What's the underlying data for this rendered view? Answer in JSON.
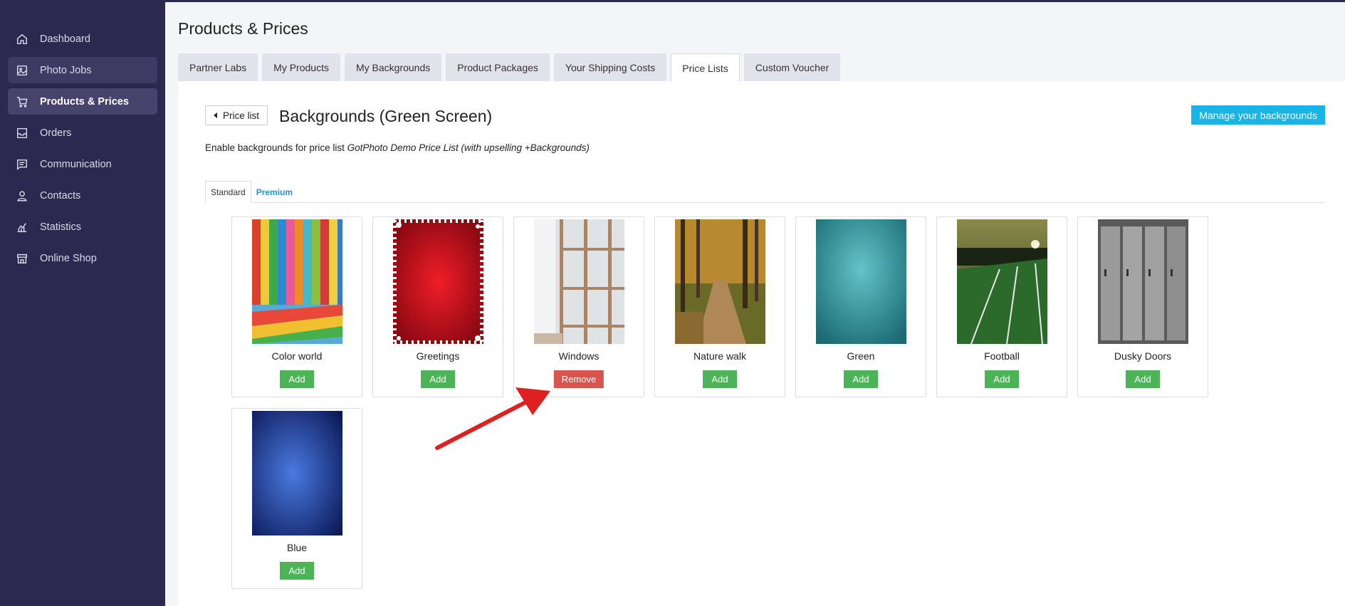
{
  "sidebar": {
    "items": [
      {
        "label": "Dashboard",
        "icon": "home-icon"
      },
      {
        "label": "Photo Jobs",
        "icon": "image-icon"
      },
      {
        "label": "Products & Prices",
        "icon": "cart-icon"
      },
      {
        "label": "Orders",
        "icon": "inbox-icon"
      },
      {
        "label": "Communication",
        "icon": "message-icon"
      },
      {
        "label": "Contacts",
        "icon": "person-icon"
      },
      {
        "label": "Statistics",
        "icon": "chart-icon"
      },
      {
        "label": "Online Shop",
        "icon": "store-icon"
      }
    ],
    "active_index": 2,
    "hover_index": 1
  },
  "page_title": "Products & Prices",
  "tabs": [
    "Partner Labs",
    "My Products",
    "My Backgrounds",
    "Product Packages",
    "Your Shipping Costs",
    "Price Lists",
    "Custom Voucher"
  ],
  "active_tab": 5,
  "back_button": "Price list",
  "section_title": "Backgrounds (Green Screen)",
  "manage_button": "Manage your backgrounds",
  "description_prefix": "Enable backgrounds for price list",
  "description_list": "GotPhoto Demo Price List (with upselling +Backgrounds)",
  "subtabs": [
    "Standard",
    "Premium"
  ],
  "backgrounds": [
    {
      "name": "Color world",
      "action": "Add"
    },
    {
      "name": "Greetings",
      "action": "Add"
    },
    {
      "name": "Windows",
      "action": "Remove"
    },
    {
      "name": "Nature walk",
      "action": "Add"
    },
    {
      "name": "Green",
      "action": "Add"
    },
    {
      "name": "Football",
      "action": "Add"
    },
    {
      "name": "Dusky Doors",
      "action": "Add"
    },
    {
      "name": "Blue",
      "action": "Add"
    }
  ],
  "colors": {
    "sidebar_bg": "#2c2950",
    "add_button": "#4cb457",
    "remove_button": "#d9534f",
    "manage_button": "#18b4e6",
    "annotation_arrow": "#e02020"
  }
}
